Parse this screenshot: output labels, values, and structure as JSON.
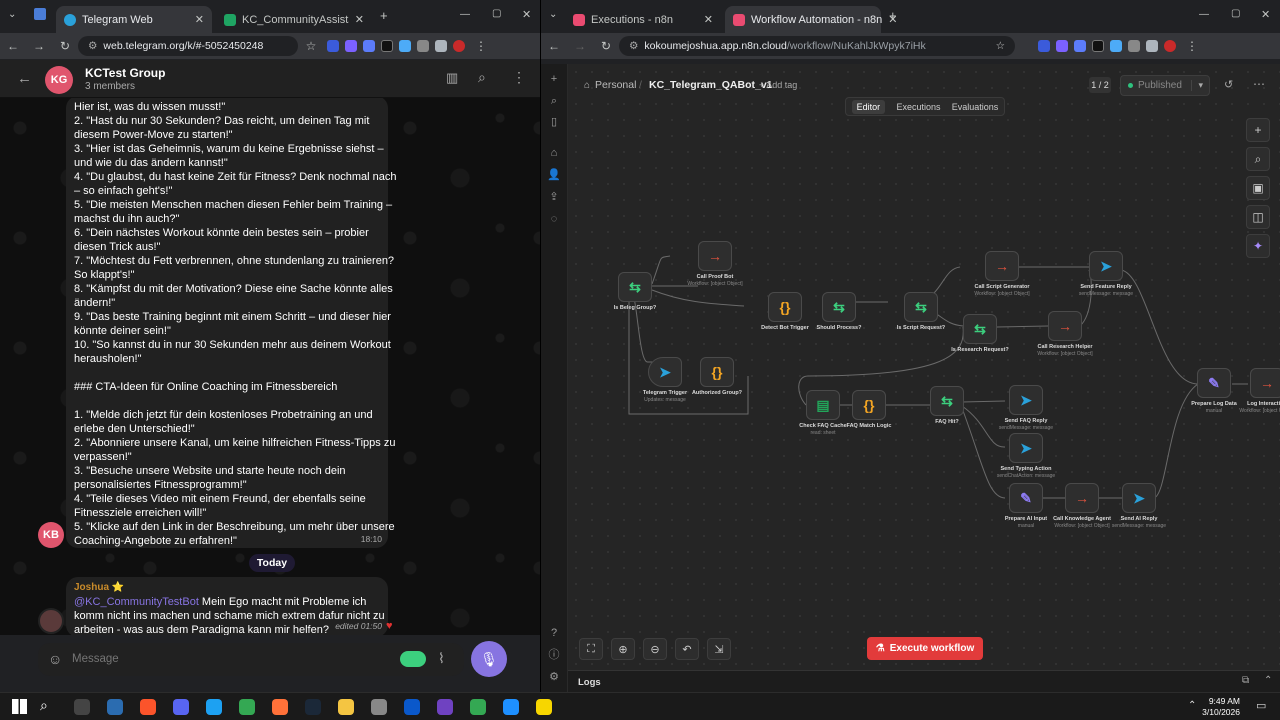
{
  "left_browser": {
    "tabs": [
      {
        "label": "Telegram Web",
        "active": true
      },
      {
        "label": "KC_CommunityAssistant_Data",
        "active": false
      }
    ],
    "url": "web.telegram.org/k/#-5052450248",
    "chat": {
      "avatar_initials": "KG",
      "title": "KCTest Group",
      "members": "3 members",
      "message_lines": [
        "Hier ist, was du wissen musst!\"",
        "2. \"Hast du nur 30 Sekunden? Das reicht, um deinen Tag mit",
        "diesem Power-Move zu starten!\"",
        "3. \"Hier ist das Geheimnis, warum du keine Ergebnisse siehst –",
        "und wie du das ändern kannst!\"",
        "4. \"Du glaubst, du hast keine Zeit für Fitness? Denk nochmal nach",
        "– so einfach geht's!\"",
        "5. \"Die meisten Menschen machen diesen Fehler beim Training –",
        "machst du ihn auch?\"",
        "6. \"Dein nächstes Workout könnte dein bestes sein – probier",
        "diesen Trick aus!\"",
        "7. \"Möchtest du Fett verbrennen, ohne stundenlang zu trainieren?",
        "So klappt's!\"",
        "8. \"Kämpfst du mit der Motivation? Diese eine Sache könnte alles",
        "ändern!\"",
        "9. \"Das beste Training beginnt mit einem Schritt – und dieser hier",
        "könnte deiner sein!\"",
        "10. \"So kannst du in nur 30 Sekunden mehr aus deinem Workout",
        "herausholen!\"",
        "",
        "### CTA-Ideen für Online Coaching im Fitnessbereich",
        "",
        "1. \"Melde dich jetzt für dein kostenloses Probetraining an und",
        "erlebe den Unterschied!\"",
        "2. \"Abonniere unsere Kanal, um keine hilfreichen Fitness-Tipps zu",
        "verpassen!\"",
        "3. \"Besuche unsere Website und starte heute noch dein",
        "personalisiertes Fitnessprogramm!\"",
        "4. \"Teile dieses Video mit einem Freund, der ebenfalls seine",
        "Fitnessziele erreichen will!\"",
        "5. \"Klicke auf den Link in der Beschreibung, um mehr über unsere",
        "Coaching-Angebote zu erfahren!\""
      ],
      "bot_avatar": "KB",
      "bot_time": "18:10",
      "date_divider": "Today",
      "reply": {
        "author": "Joshua ⭐",
        "mention": "@KC_CommunityTestBot",
        "lines": [
          " Mein Ego macht mit Probleme ich",
          "komm nicht ins machen und schame mich extrem dafur nicht zu",
          "arbeiten - was aus dem Paradigma kann mir helfen?"
        ],
        "meta": "edited 01:50",
        "reaction": "❤️"
      },
      "input_placeholder": "Message"
    }
  },
  "right_browser": {
    "tabs": [
      {
        "label": "Executions - n8n",
        "active": false
      },
      {
        "label": "Workflow Automation - n8n",
        "active": true
      }
    ],
    "url_host": "kokoumejoshua.app.n8n.cloud",
    "url_path": "/workflow/NuKahlJkWpyk7iHk",
    "n8n": {
      "breadcrumb_scope": "Personal",
      "workflow_name": "KC_Telegram_QABot_v1",
      "add_tag": "+ Add tag",
      "version": "1 / 2",
      "published": "Published",
      "view_tabs": [
        "Editor",
        "Executions",
        "Evaluations"
      ],
      "execute_label": "Execute workflow",
      "logs_label": "Logs",
      "nodes": [
        {
          "name": "Call Proof Bot",
          "sub": "Workflow: [object Object]",
          "icon": "→",
          "color": "#e0533e"
        },
        {
          "name": "Is Beleg Group?",
          "sub": "",
          "icon": "⇆",
          "color": "#3ccf7e"
        },
        {
          "name": "Detect Bot Trigger",
          "sub": "",
          "icon": "{}",
          "color": "#f5a623"
        },
        {
          "name": "Should Process?",
          "sub": "",
          "icon": "⇆",
          "color": "#3ccf7e"
        },
        {
          "name": "Is Script Request?",
          "sub": "",
          "icon": "⇆",
          "color": "#3ccf7e"
        },
        {
          "name": "Call Script Generator",
          "sub": "Workflow: [object Object]",
          "icon": "→",
          "color": "#e0533e"
        },
        {
          "name": "Send Feature Reply",
          "sub": "sendMessage: message",
          "icon": "➤",
          "color": "#2aa1da"
        },
        {
          "name": "Is Research Request?",
          "sub": "",
          "icon": "⇆",
          "color": "#3ccf7e"
        },
        {
          "name": "Call Research Helper",
          "sub": "Workflow: [object Object]",
          "icon": "→",
          "color": "#e0533e"
        },
        {
          "name": "Telegram Trigger",
          "sub": "Updates: message",
          "icon": "➤",
          "color": "#2aa1da"
        },
        {
          "name": "Authorized Group?",
          "sub": "",
          "icon": "{}",
          "color": "#f5a623"
        },
        {
          "name": "Check FAQ Cache",
          "sub": "read: sheet",
          "icon": "▤",
          "color": "#22a55a"
        },
        {
          "name": "FAQ Match Logic",
          "sub": "",
          "icon": "{}",
          "color": "#f5a623"
        },
        {
          "name": "FAQ Hit?",
          "sub": "",
          "icon": "⇆",
          "color": "#3ccf7e"
        },
        {
          "name": "Send FAQ Reply",
          "sub": "sendMessage: message",
          "icon": "➤",
          "color": "#2aa1da"
        },
        {
          "name": "Send Typing Action",
          "sub": "sendChatAction: message",
          "icon": "➤",
          "color": "#2aa1da"
        },
        {
          "name": "Prepare AI Input",
          "sub": "manual",
          "icon": "✎",
          "color": "#8d7bf2"
        },
        {
          "name": "Call Knowledge Agent",
          "sub": "Workflow: [object Object]",
          "icon": "→",
          "color": "#e0533e"
        },
        {
          "name": "Send AI Reply",
          "sub": "sendMessage: message",
          "icon": "➤",
          "color": "#2aa1da"
        },
        {
          "name": "Prepare Log Data",
          "sub": "manual",
          "icon": "✎",
          "color": "#8d7bf2"
        },
        {
          "name": "Log Interaction",
          "sub": "Workflow: [object Object]",
          "icon": "→",
          "color": "#e0533e"
        }
      ]
    }
  },
  "taskbar": {
    "time": "9:49 AM",
    "date": "3/10/2026"
  },
  "colors": {
    "telegram_accent": "#8774e1",
    "n8n_execute": "#e23b3b",
    "published_dot": "#2ec27e"
  }
}
